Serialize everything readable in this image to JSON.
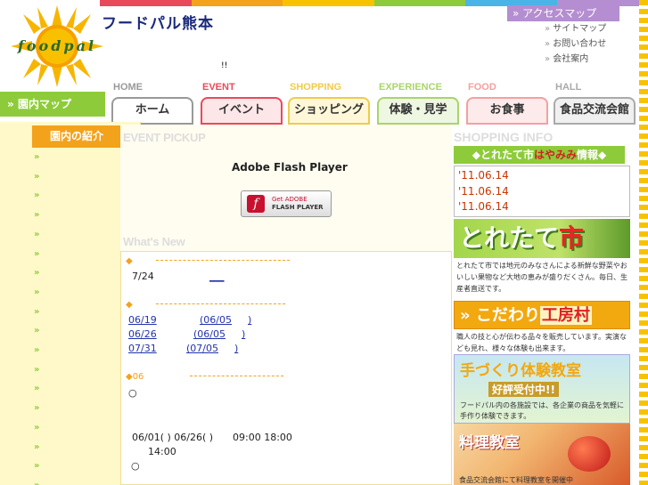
{
  "brand": "フードパル熊本",
  "logo_text": "foodpal",
  "colors": {
    "green": "#8ecb3a",
    "orange": "#f3a21c",
    "purple": "#b48ed0",
    "yellow": "#f7c300"
  },
  "header": {
    "access_map": "アクセスマップ",
    "links": [
      "サイトマップ",
      "お問い合わせ",
      "会社案内"
    ],
    "notice": "!!"
  },
  "nav": {
    "tabs": [
      {
        "en": "HOME",
        "jp": "ホーム",
        "color": "#999999"
      },
      {
        "en": "EVENT",
        "jp": "イベント",
        "color": "#e84a5a"
      },
      {
        "en": "SHOPPING",
        "jp": "ショッピング",
        "color": "#f0cb4a"
      },
      {
        "en": "EXPERIENCE",
        "jp": "体験・見学",
        "color": "#a9d46c"
      },
      {
        "en": "FOOD",
        "jp": "お食事",
        "color": "#f4a0a0"
      },
      {
        "en": "HALL",
        "jp": "食品交流会館",
        "color": "#aaaaaa"
      }
    ]
  },
  "sidebar": {
    "map_button": "園内マップ",
    "intro_heading": "園内の紹介",
    "item_marker": "»",
    "item_count": 18
  },
  "main": {
    "event_pickup": "EVENT PICKUP",
    "flash_title": "Adobe Flash Player",
    "flash_button": {
      "line1": "Get ADOBE",
      "line2": "FLASH PLAYER",
      "icon": "f"
    },
    "whats_new": "What's New",
    "news": {
      "bullet": "◆",
      "bullet_06": "◆06",
      "date_724": "7/24",
      "link_724": "___",
      "rows": [
        {
          "a": "06/19",
          "b": "(06/05",
          "c": ")"
        },
        {
          "a": "06/26",
          "b": "(06/05",
          "c": ")"
        },
        {
          "a": "07/31",
          "b": "(07/05",
          "c": ")"
        }
      ],
      "circle": "○",
      "schedule_dates": "06/01( ) 06/26( )",
      "schedule_time": "09:00 18:00",
      "schedule_time2": "14:00"
    }
  },
  "right": {
    "shopping_info": "SHOPPING INFO",
    "rest_prefix": "◆とれたて市",
    "rest_red": "はやみみ",
    "rest_suffix": "情報◆",
    "dates": [
      "'11.06.14",
      "'11.06.14",
      "'11.06.14"
    ],
    "toretate_title": "とれたて",
    "toretate_ichi": "市",
    "toretate_desc": "とれたて市では地元のみなさんによる新鮮な野菜やおいしい果物など大地の恵みが盛りだくさん。毎日、生産者直送です。",
    "kodawari_prefix": "こだわり",
    "kodawari_red": "工房村",
    "kodawari_desc": "職人の技と心が伝わる品々を販売しています。実演なども見れ、様々な体験も出来ます。",
    "taiken_title": "手づくり体験教室",
    "taiken_reception": "好評受付中!!",
    "taiken_desc": "フードパル内の各施設では、各企業の商品を気軽に手作り体験できます。",
    "ryori_title": "料理教室",
    "ryori_desc": "食品交流会館にて料理教室を開催中"
  }
}
